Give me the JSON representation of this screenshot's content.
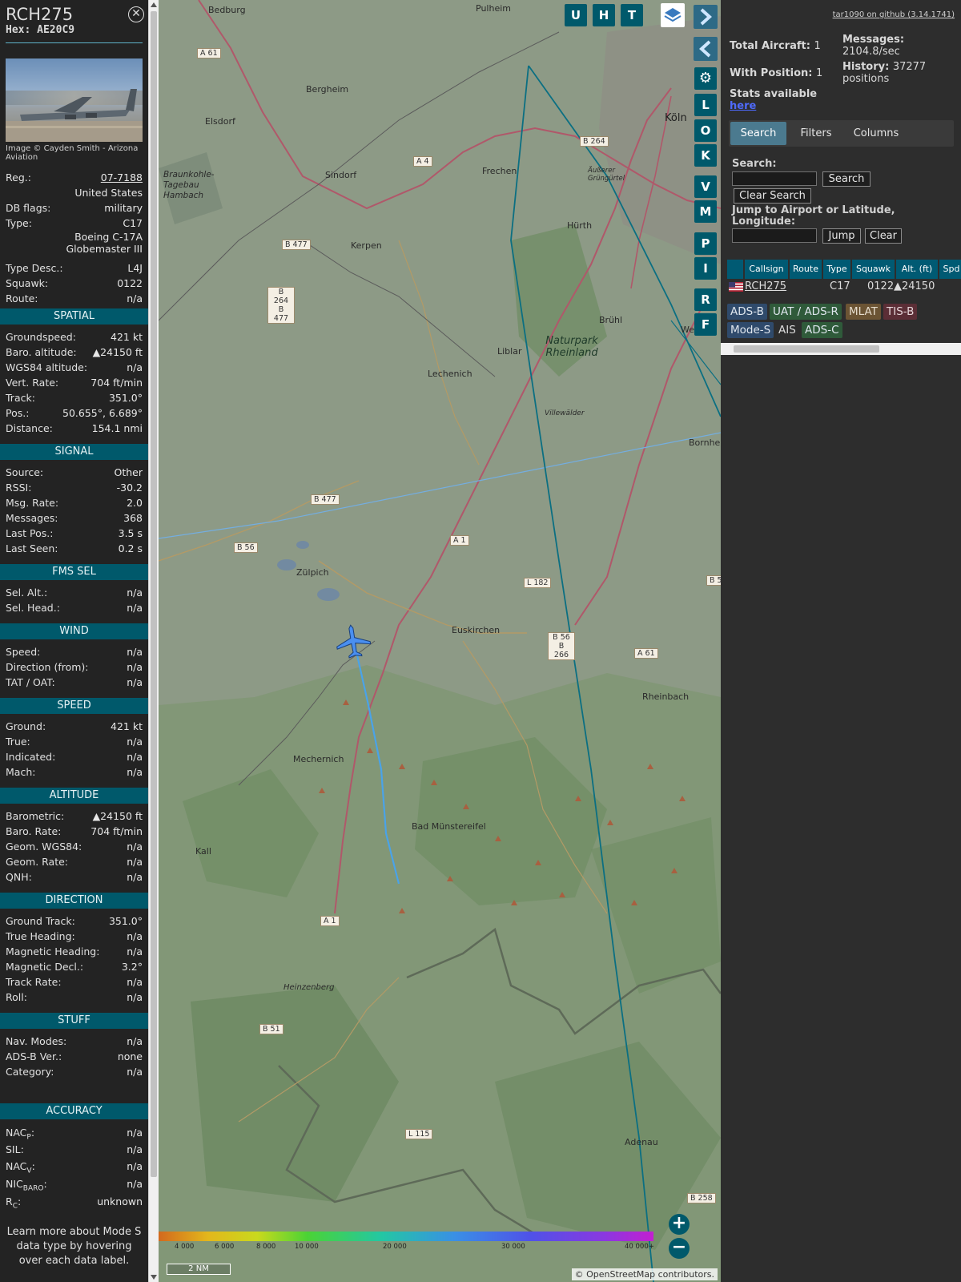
{
  "aircraft": {
    "callsign": "RCH275",
    "hex": "Hex: AE20C9",
    "photo_credit": "Image © Cayden Smith - Arizona Aviation",
    "reg_label": "Reg.:",
    "reg": "07-7188",
    "country": "United States",
    "db_flags_label": "DB flags:",
    "db_flags": "military",
    "type_label": "Type:",
    "type": "C17",
    "type_full_1": "Boeing C-17A",
    "type_full_2": "Globemaster III",
    "type_desc_label": "Type Desc.:",
    "type_desc": "L4J",
    "squawk_label": "Squawk:",
    "squawk": "0122",
    "route_label": "Route:",
    "route": "n/a"
  },
  "sections": {
    "spatial": "SPATIAL",
    "signal": "SIGNAL",
    "fms": "FMS SEL",
    "wind": "WIND",
    "speed": "SPEED",
    "altitude": "ALTITUDE",
    "direction": "DIRECTION",
    "stuff": "STUFF",
    "accuracy": "ACCURACY"
  },
  "spatial": [
    {
      "k": "Groundspeed:",
      "v": "421 kt"
    },
    {
      "k": "Baro. altitude:",
      "v": "▲24150 ft"
    },
    {
      "k": "WGS84 altitude:",
      "v": "n/a"
    },
    {
      "k": "Vert. Rate:",
      "v": "704 ft/min"
    },
    {
      "k": "Track:",
      "v": "351.0°"
    },
    {
      "k": "Pos.:",
      "v": "50.655°, 6.689°"
    },
    {
      "k": "Distance:",
      "v": "154.1 nmi"
    }
  ],
  "signal": [
    {
      "k": "Source:",
      "v": "Other"
    },
    {
      "k": "RSSI:",
      "v": "-30.2"
    },
    {
      "k": "Msg. Rate:",
      "v": "2.0"
    },
    {
      "k": "Messages:",
      "v": "368"
    },
    {
      "k": "Last Pos.:",
      "v": "3.5 s"
    },
    {
      "k": "Last Seen:",
      "v": "0.2 s"
    }
  ],
  "fms": [
    {
      "k": "Sel. Alt.:",
      "v": "n/a"
    },
    {
      "k": "Sel. Head.:",
      "v": "n/a"
    }
  ],
  "wind": [
    {
      "k": "Speed:",
      "v": "n/a"
    },
    {
      "k": "Direction (from):",
      "v": "n/a"
    },
    {
      "k": "TAT / OAT:",
      "v": "n/a"
    }
  ],
  "speed": [
    {
      "k": "Ground:",
      "v": "421 kt"
    },
    {
      "k": "True:",
      "v": "n/a"
    },
    {
      "k": "Indicated:",
      "v": "n/a"
    },
    {
      "k": "Mach:",
      "v": "n/a"
    }
  ],
  "altitude": [
    {
      "k": "Barometric:",
      "v": "▲24150 ft"
    },
    {
      "k": "Baro. Rate:",
      "v": "704 ft/min"
    },
    {
      "k": "Geom. WGS84:",
      "v": "n/a"
    },
    {
      "k": "Geom. Rate:",
      "v": "n/a"
    },
    {
      "k": "QNH:",
      "v": "n/a"
    }
  ],
  "direction": [
    {
      "k": "Ground Track:",
      "v": "351.0°"
    },
    {
      "k": "True Heading:",
      "v": "n/a"
    },
    {
      "k": "Magnetic Heading:",
      "v": "n/a"
    },
    {
      "k": "Magnetic Decl.:",
      "v": "3.2°"
    },
    {
      "k": "Track Rate:",
      "v": "n/a"
    },
    {
      "k": "Roll:",
      "v": "n/a"
    }
  ],
  "stuff": [
    {
      "k": "Nav. Modes:",
      "v": "n/a"
    },
    {
      "k": "ADS-B Ver.:",
      "v": "none"
    },
    {
      "k": "Category:",
      "v": "n/a"
    }
  ],
  "accuracy": {
    "nacp_k": "NAC",
    "nacp_sub": "P",
    "nacp_v": "n/a",
    "sil_k": "SIL:",
    "sil_v": "n/a",
    "nacv_k": "NAC",
    "nacv_sub": "V",
    "nacv_v": "n/a",
    "nicbaro_k": "NIC",
    "nicbaro_sub": "BARO",
    "nicbaro_v": "n/a",
    "rc_k": "R",
    "rc_sub": "C",
    "rc_v": "unknown"
  },
  "footer": "Learn more about Mode S data type by hovering over each data label.",
  "map": {
    "buttons_top": [
      "U",
      "H",
      "T"
    ],
    "buttons_side": [
      "L",
      "O",
      "K",
      "V",
      "M",
      "P",
      "I",
      "R",
      "F"
    ],
    "places": [
      "Bedburg",
      "Pulheim",
      "Bergheim",
      "Elsdorf",
      "Sindorf",
      "Braunkohle-Tagebau Hambach",
      "Frechen",
      "Köln",
      "Kerpen",
      "Hürth",
      "Brühl",
      "Liblar",
      "Lechenich",
      "Naturpark Rheinland",
      "Villewälder",
      "Bornhe",
      "Zülpich",
      "Euskirchen",
      "Rheinbach",
      "Mechernich",
      "Bad Münstereifel",
      "Kall",
      "Heinzenberg",
      "Adenau",
      "Äußerer Grüngürtel",
      "Wes"
    ],
    "roads": [
      "A 61",
      "A 4",
      "B 264",
      "B 477",
      "B 264 B 477",
      "B 477",
      "B 56",
      "A 1",
      "L 182",
      "B 56 B 266",
      "A 61",
      "A 1",
      "B 51",
      "L 115",
      "B 258",
      "B 5"
    ],
    "colorbar_ticks": [
      "4 000",
      "6 000",
      "8 000",
      "10 000",
      "20 000",
      "30 000",
      "40 000+"
    ],
    "scale": "2 NM",
    "attribution": "© OpenStreetMap contributors."
  },
  "right": {
    "github": "tar1090 on github (3.14.1741)",
    "total_label": "Total Aircraft:",
    "total": "1",
    "withpos_label": "With Position:",
    "withpos": "1",
    "messages_label": "Messages:",
    "messages": "2104.8/sec",
    "history_label": "History:",
    "history": "37277 positions",
    "stats_label": "Stats available",
    "stats_link": "here",
    "tabs": [
      "Search",
      "Filters",
      "Columns"
    ],
    "search_label": "Search:",
    "search_btn": "Search",
    "clear_search_btn": "Clear Search",
    "jump_label": "Jump to Airport or Latitude, Longitude:",
    "jump_btn": "Jump",
    "clear_btn": "Clear",
    "columns": [
      "",
      "Callsign",
      "Route",
      "Type",
      "Squawk",
      "Alt. (ft)",
      "Spd"
    ],
    "row": {
      "callsign": "RCH275",
      "type": "C17",
      "squawk": "0122",
      "alt": "▲24150"
    },
    "legend": [
      "ADS-B",
      "UAT / ADS-R",
      "MLAT",
      "TIS-B",
      "Mode-S",
      "AIS",
      "ADS-C"
    ]
  },
  "colors": {
    "accent": "#00596b",
    "track": "#4aa3e8",
    "panel": "#232323"
  }
}
